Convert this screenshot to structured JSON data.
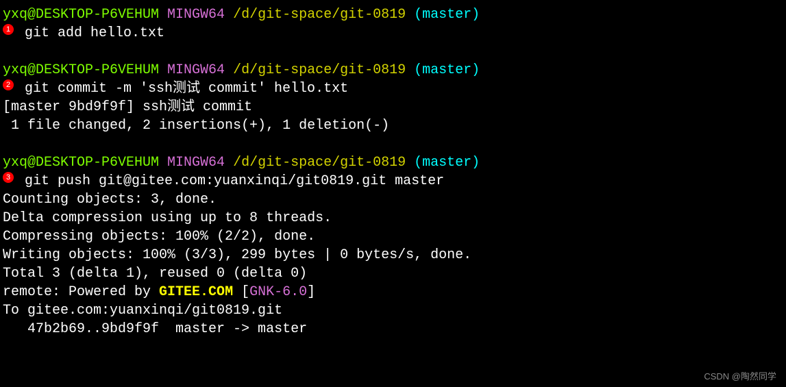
{
  "prompts": [
    {
      "user": "yxq@DESKTOP-P6VEHUM",
      "mingw": " MINGW64 ",
      "path": "/d/git-space/git-0819",
      "branch": " (master)"
    },
    {
      "user": "yxq@DESKTOP-P6VEHUM",
      "mingw": " MINGW64 ",
      "path": "/d/git-space/git-0819",
      "branch": " (master)"
    },
    {
      "user": "yxq@DESKTOP-P6VEHUM",
      "mingw": " MINGW64 ",
      "path": "/d/git-space/git-0819",
      "branch": " (master)"
    }
  ],
  "badges": {
    "b1": "1",
    "b2": "2",
    "b3": "3"
  },
  "commands": {
    "cmd1": " git add hello.txt",
    "cmd2": " git commit -m 'ssh测试 commit' hello.txt",
    "cmd3": " git push git@gitee.com:yuanxinqi/git0819.git master"
  },
  "output": {
    "commit1": "[master 9bd9f9f] ssh测试 commit",
    "commit2": " 1 file changed, 2 insertions(+), 1 deletion(-)",
    "push1": "Counting objects: 3, done.",
    "push2": "Delta compression using up to 8 threads.",
    "push3": "Compressing objects: 100% (2/2), done.",
    "push4": "Writing objects: 100% (3/3), 299 bytes | 0 bytes/s, done.",
    "push5": "Total 3 (delta 1), reused 0 (delta 0)",
    "remote_prefix": "remote: Powered by ",
    "remote_gitee": "GITEE.COM",
    "remote_bracket_open": " [",
    "remote_gnk": "GNK-6.0",
    "remote_bracket_close": "]",
    "push7": "To gitee.com:yuanxinqi/git0819.git",
    "push8": "   47b2b69..9bd9f9f  master -> master"
  },
  "watermark": "CSDN @陶然同学"
}
